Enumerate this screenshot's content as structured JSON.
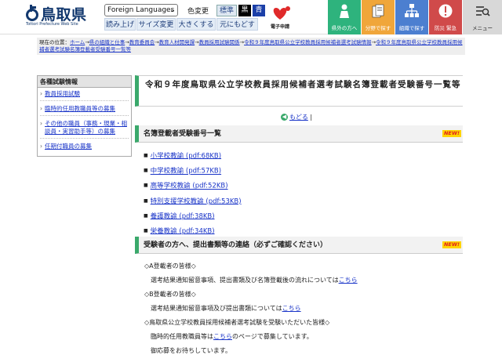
{
  "header": {
    "logo_text": "鳥取県",
    "logo_sub": "Tottori Prefecture Web Site",
    "language_select": "Foreign Languages",
    "color_label": "色変更",
    "color_options": [
      "標準",
      "黒",
      "青"
    ],
    "tools": [
      "読み上げ",
      "サイズ変更",
      "大きくする",
      "元にもどす"
    ],
    "denshi_label": "電子申請",
    "nav": [
      "県外の方へ",
      "分野で探す",
      "組織で探す",
      "防災 緊急",
      "メニュー"
    ]
  },
  "breadcrumb": {
    "prefix": "現在の位置：",
    "items": [
      "ホーム",
      "県の組織と仕事",
      "教育委員会",
      "教育人材開発課",
      "教員採用試験関係",
      "令和９年度鳥取県公立学校教員採用候補者選考試験情報",
      "令和９年度鳥取県公立学校教員採用候補者選考試験名簿登載者受験番号一覧等"
    ]
  },
  "sidebar": {
    "title": "各種試験情報",
    "items": [
      "教員採用試験",
      "臨時的任用教職員等の募集",
      "その他の職員（事務・現業・相談員・実習助手等）の募集",
      "任期付職員の募集"
    ]
  },
  "main": {
    "title": "令和９年度鳥取県公立学校教員採用候補者選考試験名簿登載者受験番号一覧等",
    "back_label": "もどる",
    "list_heading": "名簿登載者受験番号一覧",
    "new_badge": "NEW!",
    "pdf_items": [
      "小学校教諭 (pdf:68KB)",
      "中学校教諭 (pdf:57KB)",
      "高等学校教諭 (pdf:52KB)",
      "特別支援学校教諭 (pdf:53KB)",
      "養護教諭 (pdf:38KB)",
      "栄養教諭 (pdf:34KB)"
    ],
    "notice_heading": "受験者の方へ、提出書類等の連絡（必ずご確認ください）",
    "notice": {
      "a_title": "◇A登載者の皆様◇",
      "a_text": "選考結果通知留意事項、提出書類及び名簿登載後の流れについては",
      "a_link": "こちら",
      "b_title": "◇B登載者の皆様◇",
      "b_text": "選考結果通知留意事項及び提出書類については",
      "b_link": "こちら",
      "c_title": "◇鳥取県公立学校教員採用候補者選考試験を受験いただいた皆様◇",
      "c_text1": "臨時的任用教職員等は",
      "c_link": "こちら",
      "c_text2": "のページで募集しています。",
      "c_text3": "御応募をお待ちしています。"
    }
  },
  "colors": {
    "accent_green": "#3aa96b",
    "logo_navy": "#12386e",
    "link_blue": "#1a35c8"
  }
}
